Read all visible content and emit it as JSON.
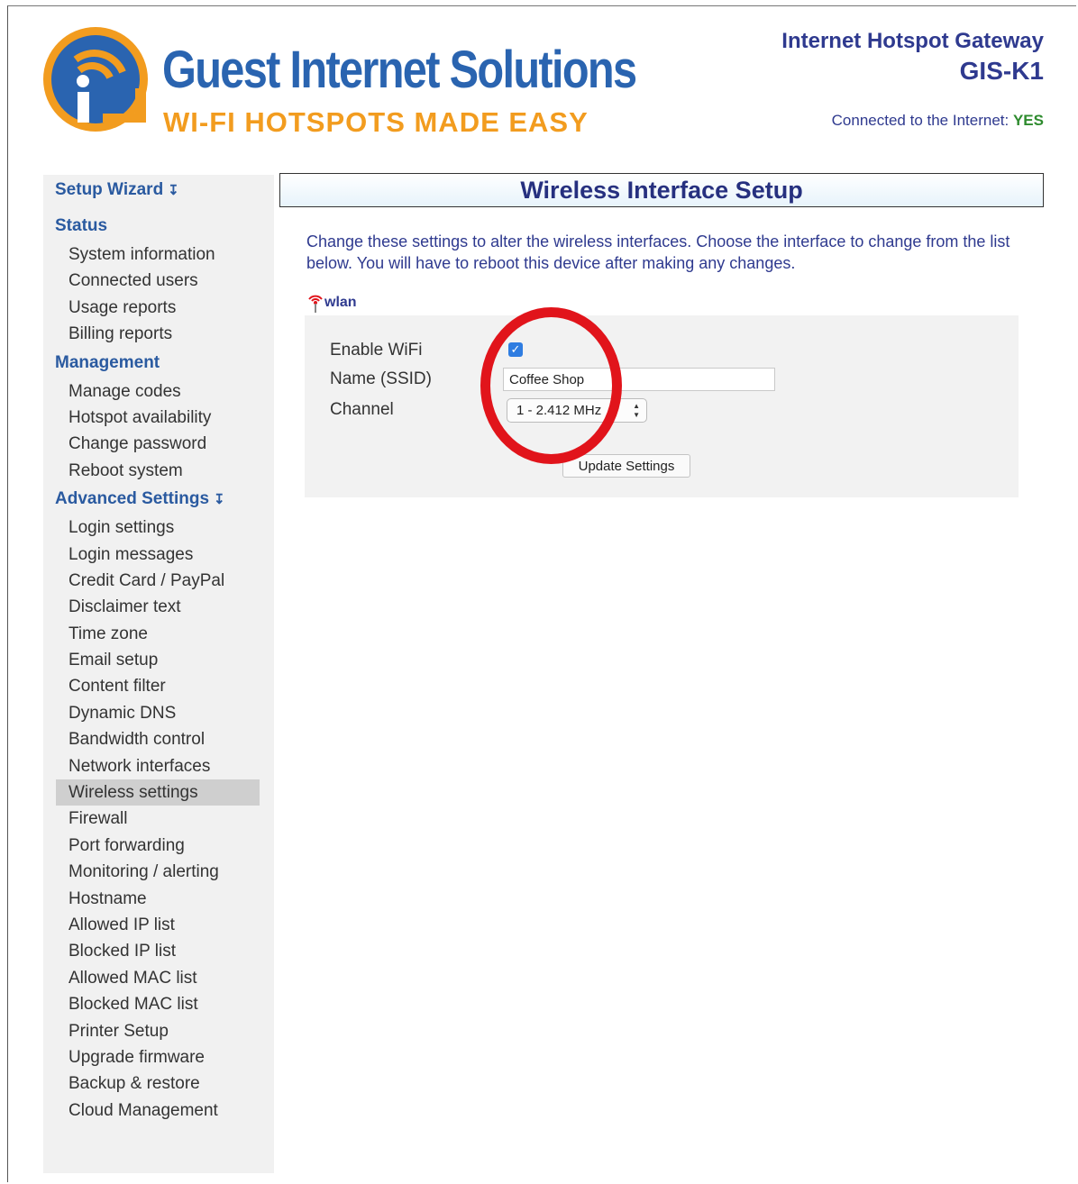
{
  "header": {
    "brand_name": "Guest Internet Solutions",
    "tagline": "WI-FI HOTSPOTS MADE EASY",
    "product": "Internet Hotspot Gateway",
    "model": "GIS-K1",
    "connection_label": "Connected to the Internet:",
    "connection_value": "YES"
  },
  "sidebar": {
    "setup_wizard": "Setup Wizard",
    "status": {
      "heading": "Status",
      "items": [
        "System information",
        "Connected users",
        "Usage reports",
        "Billing reports"
      ]
    },
    "management": {
      "heading": "Management",
      "items": [
        "Manage codes",
        "Hotspot availability",
        "Change password",
        "Reboot system"
      ]
    },
    "advanced": {
      "heading": "Advanced Settings",
      "items": [
        "Login settings",
        "Login messages",
        "Credit Card / PayPal",
        "Disclaimer text",
        "Time zone",
        "Email setup",
        "Content filter",
        "Dynamic DNS",
        "Bandwidth control",
        "Network interfaces",
        "Wireless settings",
        "Firewall",
        "Port forwarding",
        "Monitoring / alerting",
        "Hostname",
        "Allowed IP list",
        "Blocked IP list",
        "Allowed MAC list",
        "Blocked MAC list",
        "Printer Setup",
        "Upgrade firmware",
        "Backup & restore",
        "Cloud Management"
      ],
      "active": "Wireless settings"
    }
  },
  "main": {
    "title": "Wireless Interface Setup",
    "description": "Change these settings to alter the wireless interfaces. Choose the interface to change from the list below. You will have to reboot this device after making any changes.",
    "interface_name": "wlan",
    "form": {
      "enable_label": "Enable WiFi",
      "enable_checked": true,
      "name_label": "Name (SSID)",
      "name_value": "Coffee Shop",
      "channel_label": "Channel",
      "channel_value": "1 - 2.412 MHz",
      "update_button": "Update Settings"
    }
  },
  "colors": {
    "brand_blue": "#2a64b0",
    "brand_orange": "#f29c1f",
    "header_text": "#2f3a8f",
    "annotation": "#e1141b"
  }
}
